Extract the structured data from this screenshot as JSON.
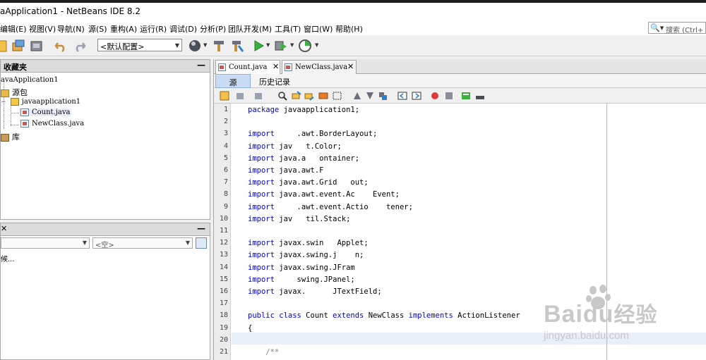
{
  "window": {
    "title": "aApplication1 - NetBeans IDE 8.2"
  },
  "menu": [
    "编辑(E)",
    "视图(V)",
    "导航(N)",
    "源(S)",
    "重构(A)",
    "运行(R)",
    "调试(D)",
    "分析(P)",
    "团队开发(M)",
    "工具(T)",
    "窗口(W)",
    "帮助(H)"
  ],
  "search": {
    "icon": "search-icon",
    "placeholder": "搜索 (Ctrl+"
  },
  "toolbar": {
    "config": "<默认配置>"
  },
  "favorites": {
    "title": "收藏夹",
    "tree": {
      "project": "avaApplication1",
      "source_packages": "源包",
      "package": "javaapplication1",
      "file_count": "Count.java",
      "file_newclass": "NewClass.java",
      "libraries": "库"
    }
  },
  "navigator": {
    "combo2": "<空>",
    "waiting": "候..."
  },
  "editor": {
    "tabs": [
      {
        "label": "Count.java"
      },
      {
        "label": "NewClass.java"
      }
    ],
    "subtabs": [
      "源",
      "历史记录"
    ],
    "lines": [
      {
        "n": "1",
        "kw": "package",
        "rest": " javaapplication1;"
      },
      {
        "n": "2",
        "kw": "",
        "rest": ""
      },
      {
        "n": "3",
        "kw": "import",
        "rest": "     .awt.BorderLayout;"
      },
      {
        "n": "4",
        "kw": "import",
        "rest": " jav   t.Color;"
      },
      {
        "n": "5",
        "kw": "import",
        "rest": " java.a   ontainer;"
      },
      {
        "n": "6",
        "kw": "import",
        "rest": " java.awt.F"
      },
      {
        "n": "7",
        "kw": "import",
        "rest": " java.awt.Grid   out;"
      },
      {
        "n": "8",
        "kw": "import",
        "rest": " java.awt.event.Ac    Event;"
      },
      {
        "n": "9",
        "kw": "import",
        "rest": "     .awt.event.Actio    tener;"
      },
      {
        "n": "10",
        "kw": "import",
        "rest": " jav   til.Stack;"
      },
      {
        "n": "11",
        "kw": "",
        "rest": ""
      },
      {
        "n": "12",
        "kw": "import",
        "rest": " javax.swin   Applet;"
      },
      {
        "n": "13",
        "kw": "import",
        "rest": " javax.swing.j    n;"
      },
      {
        "n": "14",
        "kw": "import",
        "rest": " javax.swing.JFram"
      },
      {
        "n": "15",
        "kw": "import",
        "rest": "     swing.JPanel;"
      },
      {
        "n": "16",
        "kw": "import",
        "rest": " javax.      JTextField;"
      },
      {
        "n": "17",
        "kw": "",
        "rest": ""
      },
      {
        "n": "18",
        "kw": "public class",
        "rest": " Count ",
        "kw2": "extends",
        "rest2": " NewClass ",
        "kw3": "implements",
        "rest3": " ActionListener"
      },
      {
        "n": "19",
        "kw": "",
        "rest": "{"
      },
      {
        "n": "20",
        "kw": "",
        "rest": ""
      },
      {
        "n": "21",
        "kw": "",
        "rest": "",
        "comment": "    /**"
      }
    ]
  },
  "watermark": {
    "brand": "Baidu",
    "brand_cn": "经验",
    "url": "jingyan.baidu.com"
  }
}
